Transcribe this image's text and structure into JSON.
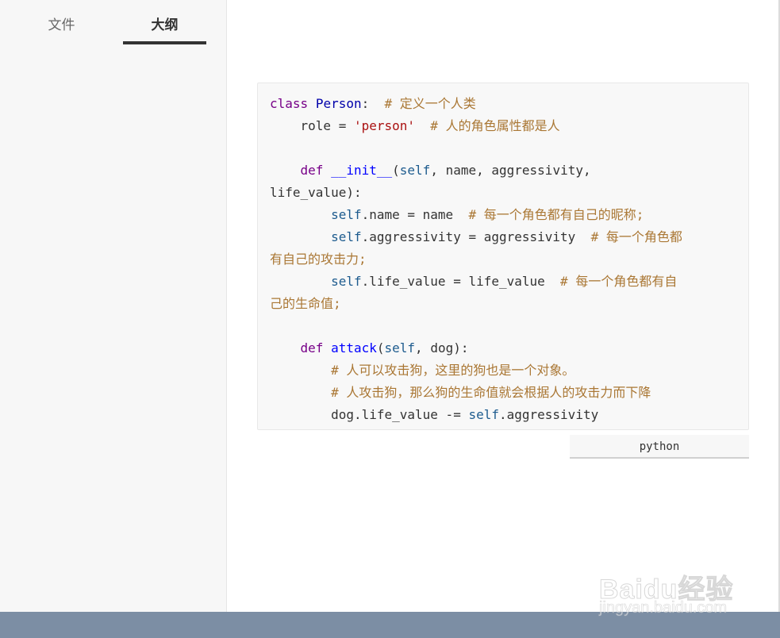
{
  "sidebar": {
    "tabs": [
      {
        "label": "文件",
        "active": false
      },
      {
        "label": "大纲",
        "active": true
      }
    ]
  },
  "code_block": {
    "language": "python",
    "lines": [
      "class Person:  # 定义一个人类",
      "    role = 'person'  # 人的角色属性都是人",
      "",
      "    def __init__(self, name, aggressivity,",
      "life_value):",
      "        self.name = name  # 每一个角色都有自己的昵称;",
      "        self.aggressivity = aggressivity  # 每一个角色都",
      "有自己的攻击力;",
      "        self.life_value = life_value  # 每一个角色都有自",
      "己的生命值;",
      "",
      "    def attack(self, dog):",
      "        # 人可以攻击狗，这里的狗也是一个对象。",
      "        # 人攻击狗，那么狗的生命值就会根据人的攻击力而下降",
      "        dog.life_value -= self.aggressivity"
    ]
  },
  "watermark": {
    "main": "Baidu经验",
    "sub": "jingyan.baidu.com"
  },
  "colors": {
    "sidebar_bg": "#f7f7f7",
    "code_bg": "#f8f8f8",
    "keyword": "#770088",
    "definition": "#0000ff",
    "self": "#1d5b8e",
    "string": "#aa1111",
    "comment": "#aa7734",
    "footer": "#7c8ea4"
  }
}
